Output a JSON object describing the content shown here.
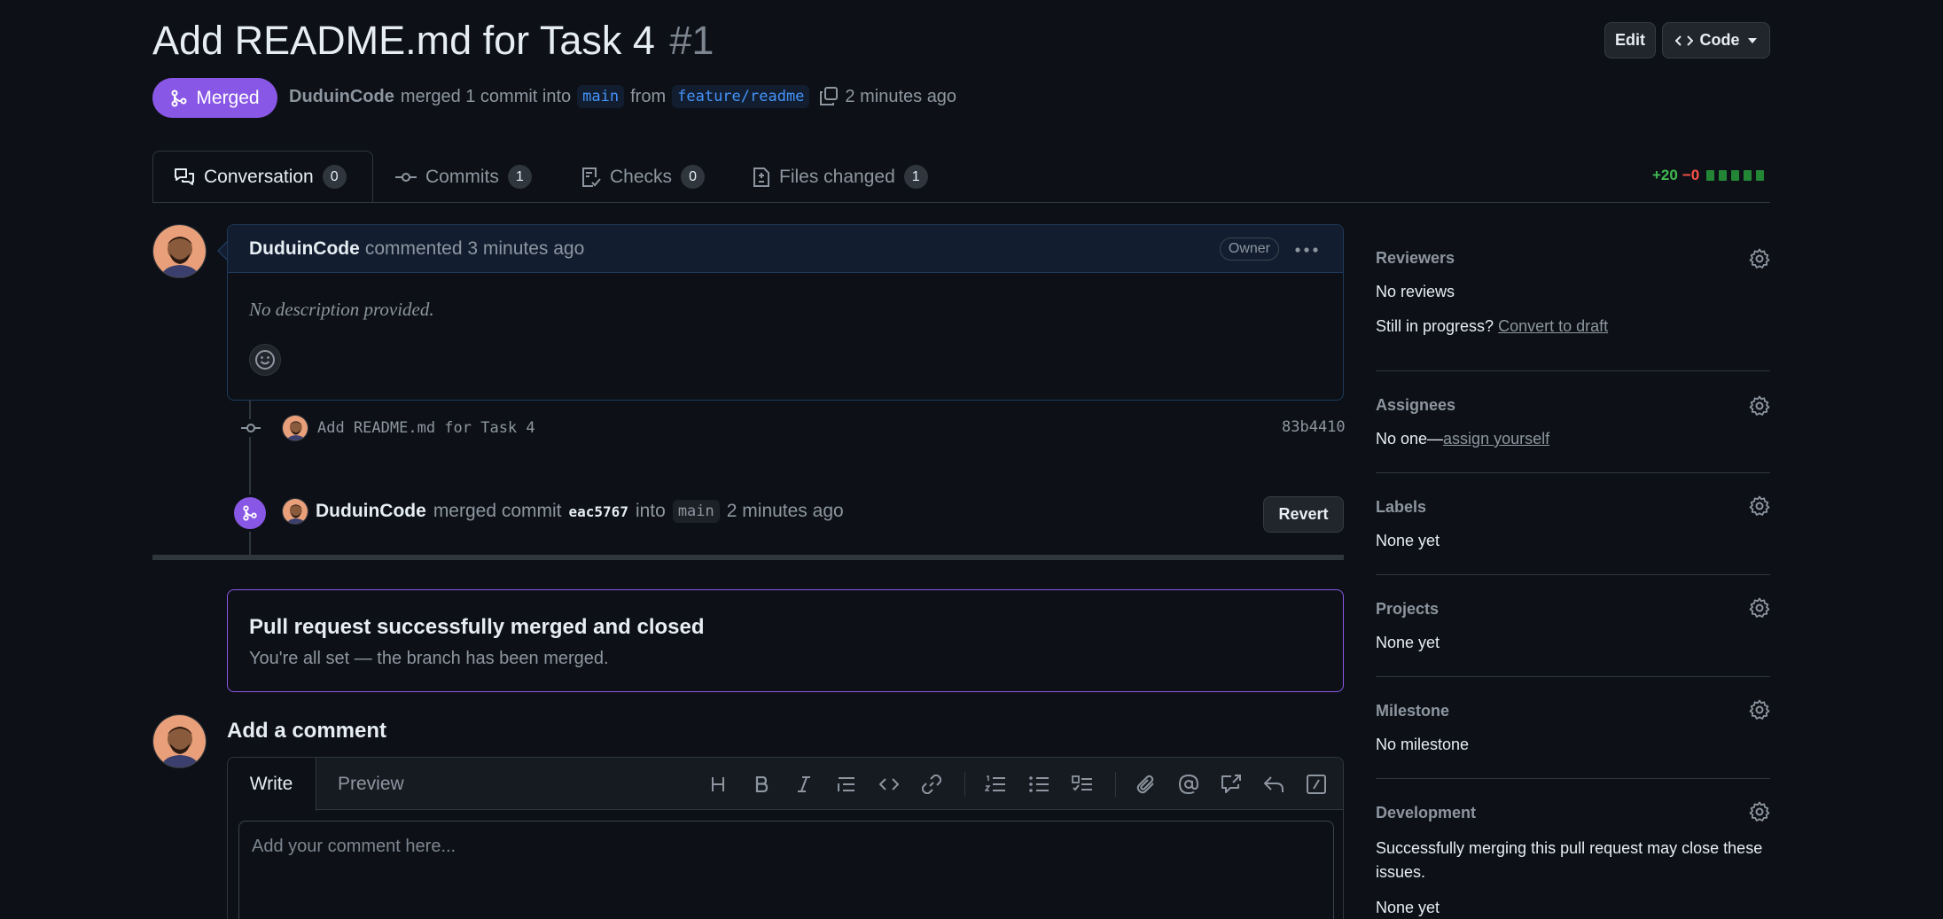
{
  "header": {
    "title": "Add README.md for Task 4",
    "number": "#1",
    "edit_label": "Edit",
    "code_label": "Code",
    "status": "Merged",
    "author": "DuduinCode",
    "merged_text": "merged 1 commit into",
    "base_branch": "main",
    "from_text": "from",
    "head_branch": "feature/readme",
    "time": "2 minutes ago"
  },
  "tabs": [
    {
      "label": "Conversation",
      "count": "0"
    },
    {
      "label": "Commits",
      "count": "1"
    },
    {
      "label": "Checks",
      "count": "0"
    },
    {
      "label": "Files changed",
      "count": "1"
    }
  ],
  "diffstat": {
    "additions": "+20",
    "deletions": "−0"
  },
  "comment": {
    "author": "DuduinCode",
    "action": "commented 3 minutes ago",
    "badge": "Owner",
    "body": "No description provided."
  },
  "commit": {
    "message": "Add README.md for Task 4",
    "sha": "83b4410"
  },
  "merge_event": {
    "author": "DuduinCode",
    "text": "merged commit",
    "sha": "eac5767",
    "into": "into",
    "branch": "main",
    "time": "2 minutes ago",
    "revert_label": "Revert"
  },
  "merge_box": {
    "title": "Pull request successfully merged and closed",
    "subtitle": "You're all set — the branch has been merged."
  },
  "add_comment": {
    "heading": "Add a comment",
    "write_tab": "Write",
    "preview_tab": "Preview",
    "placeholder": "Add your comment here..."
  },
  "sidebar": {
    "reviewers": {
      "title": "Reviewers",
      "value": "No reviews",
      "progress_text": "Still in progress?",
      "progress_link": "Convert to draft"
    },
    "assignees": {
      "title": "Assignees",
      "value": "No one—",
      "link": "assign yourself"
    },
    "labels": {
      "title": "Labels",
      "value": "None yet"
    },
    "projects": {
      "title": "Projects",
      "value": "None yet"
    },
    "milestone": {
      "title": "Milestone",
      "value": "No milestone"
    },
    "development": {
      "title": "Development",
      "text": "Successfully merging this pull request may close these issues.",
      "value": "None yet"
    }
  },
  "colors": {
    "merged": "#8957e5",
    "added": "#3fb950",
    "deleted": "#f85149",
    "link": "#4493f8"
  }
}
